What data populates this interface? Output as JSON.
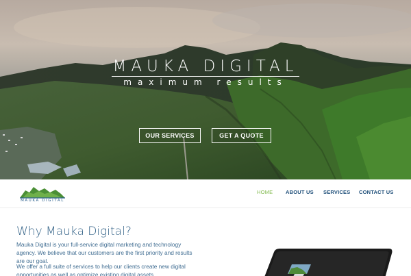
{
  "hero": {
    "brand_title": "MAUKA DIGITAL",
    "tagline": "maximum results",
    "buttons": {
      "services": "OUR SERVICES",
      "quote": "GET A QUOTE"
    }
  },
  "nav": {
    "logo_text": "MAUKA DIGITAL",
    "items": [
      {
        "label": "HOME",
        "active": true
      },
      {
        "label": "ABOUT US",
        "active": false
      },
      {
        "label": "SERVICES",
        "active": false
      },
      {
        "label": "CONTACT US",
        "active": false
      }
    ]
  },
  "content": {
    "heading": "Why Mauka Digital?",
    "paragraph_1": "Mauka Digital is your full-service digital marketing and technology agency. We believe that our  customers are the first priority and results are our goal.",
    "paragraph_2": "We offer a full suite of services to help our clients create new digital opportunities as well as optimize existing digital assets."
  },
  "colors": {
    "accent_green": "#7fb84a",
    "nav_blue": "#1f4f7a",
    "text_blue": "#3f6c91"
  }
}
